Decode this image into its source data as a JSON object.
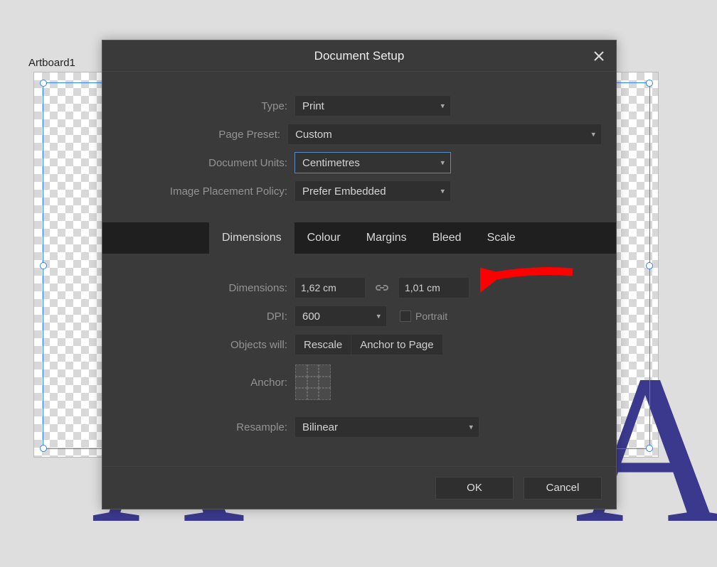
{
  "artboard_label": "Artboard1",
  "dialog": {
    "title": "Document Setup",
    "labels": {
      "type": "Type:",
      "page_preset": "Page Preset:",
      "doc_units": "Document Units:",
      "img_policy": "Image Placement Policy:",
      "dimensions": "Dimensions:",
      "dpi": "DPI:",
      "objects_will": "Objects will:",
      "anchor": "Anchor:",
      "resample": "Resample:",
      "portrait": "Portrait"
    },
    "values": {
      "type": "Print",
      "page_preset": "Custom",
      "doc_units": "Centimetres",
      "img_policy": "Prefer Embedded",
      "dim_w": "1,62 cm",
      "dim_h": "1,01 cm",
      "dpi": "600",
      "resample": "Bilinear"
    },
    "tabs": [
      "Dimensions",
      "Colour",
      "Margins",
      "Bleed",
      "Scale"
    ],
    "active_tab": 0,
    "segments": {
      "rescale": "Rescale",
      "anchor_page": "Anchor to Page"
    },
    "buttons": {
      "ok": "OK",
      "cancel": "Cancel"
    }
  }
}
